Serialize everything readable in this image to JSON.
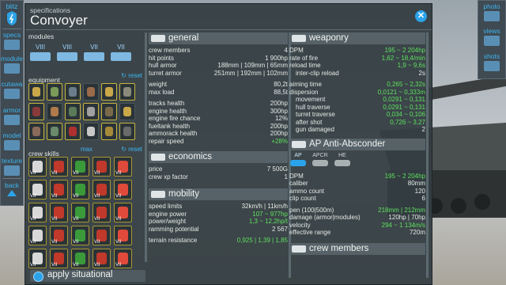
{
  "left_sidebar": [
    {
      "id": "blitz",
      "label": "blitz"
    },
    {
      "id": "specs",
      "label": "specs"
    },
    {
      "id": "module",
      "label": "module"
    },
    {
      "id": "cutaway",
      "label": "cutawa"
    },
    {
      "id": "armor",
      "label": "armor"
    },
    {
      "id": "model",
      "label": "model"
    },
    {
      "id": "texture",
      "label": "texture"
    },
    {
      "id": "back",
      "label": "back"
    }
  ],
  "right_sidebar": [
    {
      "id": "photo",
      "label": "photo"
    },
    {
      "id": "views",
      "label": "views"
    },
    {
      "id": "shots",
      "label": "shots"
    }
  ],
  "panel": {
    "subtitle": "specifications",
    "title": "Convoyer",
    "close_icon": "close-icon",
    "modules_label": "modules",
    "modules": [
      "VIII",
      "VIII",
      "VII",
      "VII"
    ],
    "equipment_label": "equipment",
    "reset_label": "reset",
    "crew_skills_label": "crew skills",
    "crew_max_label": "max",
    "equipment_cells": 18,
    "skill_levels": [
      "VII",
      "VII",
      "VII",
      "VII",
      "VII",
      "VII",
      "VII",
      "VII",
      "VII",
      "VII",
      "VII",
      "VII",
      "VII",
      "VII",
      "VII",
      "VII",
      "VII",
      "VII",
      "VII",
      "VII",
      "VII",
      "VII",
      "VII",
      "VII",
      "VII"
    ],
    "apply_label": "apply situational"
  },
  "general": {
    "header": "general",
    "rows1": [
      {
        "k": "crew members",
        "v": "4"
      },
      {
        "k": "hit points",
        "v": "1 900hp"
      },
      {
        "k": "hull armor",
        "v": "188mm | 109mm | 65mm"
      },
      {
        "k": "turret armor",
        "v": "251mm | 192mm | 102mm"
      }
    ],
    "rows2": [
      {
        "k": "weight",
        "v": "80,2t"
      },
      {
        "k": "max load",
        "v": "88,5t"
      }
    ],
    "rows3": [
      {
        "k": "tracks health",
        "v": "200hp"
      },
      {
        "k": "engine health",
        "v": "300hp"
      },
      {
        "k": "engine fire chance",
        "v": "12%"
      },
      {
        "k": "fueltank health",
        "v": "200hp"
      },
      {
        "k": "ammorack health",
        "v": "200hp"
      },
      {
        "k": "repair speed",
        "v": "+28%",
        "green": true
      }
    ]
  },
  "economics": {
    "header": "economics",
    "rows": [
      {
        "k": "price",
        "v": "7 500G"
      },
      {
        "k": "crew xp factor",
        "v": "1"
      }
    ]
  },
  "mobility": {
    "header": "mobility",
    "rows": [
      {
        "k": "speed limits",
        "v": "32km/h | 11km/h"
      },
      {
        "k": "engine power",
        "v": "107 ~ 977hp",
        "green": true
      },
      {
        "k": "power/weight",
        "v": "1,3 ~ 12,2hp/t",
        "green": true
      },
      {
        "k": "ramming potential",
        "v": "2 567"
      }
    ],
    "rows2": [
      {
        "k": "terrain resistance",
        "v": "0,925 | 1,39 | 1,85",
        "green": true
      }
    ]
  },
  "weaponry": {
    "header": "weaponry",
    "rows1": [
      {
        "k": "DPM",
        "v": "195 ~ 2 204hp",
        "green": true
      },
      {
        "k": "rate of fire",
        "v": "1,62 ~ 18,4/min",
        "green": true
      },
      {
        "k": "reload time",
        "v": "1,9 ~ 9,6s",
        "green": true
      },
      {
        "k": "inter-clip reload",
        "v": "2s",
        "ind": true
      }
    ],
    "rows2": [
      {
        "k": "aiming time",
        "v": "0,265 ~ 2,32s",
        "green": true
      },
      {
        "k": "dispersion",
        "v": "0,0121 ~ 0,333m",
        "green": true
      },
      {
        "k": "movement",
        "v": "0,0291 ~ 0,131",
        "green": true,
        "ind": true
      },
      {
        "k": "hull traverse",
        "v": "0,0291 ~ 0,131",
        "green": true,
        "ind": true
      },
      {
        "k": "turret traverse",
        "v": "0,034 ~ 0,106",
        "green": true,
        "ind": true
      },
      {
        "k": "after shot",
        "v": "0,726 ~ 3,27",
        "green": true,
        "ind": true
      },
      {
        "k": "gun damaged",
        "v": "2",
        "ind": true
      }
    ]
  },
  "gun": {
    "header": "AP Anti-Absconder",
    "ammo_types": [
      "AP",
      "APCR",
      "HE"
    ],
    "rows1": [
      {
        "k": "DPM",
        "v": "195 ~ 2 204hp",
        "green": true
      },
      {
        "k": "caliber",
        "v": "80mm"
      },
      {
        "k": "ammo count",
        "v": "120"
      },
      {
        "k": "clip count",
        "v": "6"
      }
    ],
    "rows2": [
      {
        "k": "pen (100|500m)",
        "v": "218mm | 212mm",
        "green": true
      },
      {
        "k": "damage (armor|modules)",
        "v": "120hp | 70hp"
      },
      {
        "k": "velocity",
        "v": "294 ~ 1 134m/s",
        "green": true
      },
      {
        "k": "effective range",
        "v": "720m"
      }
    ]
  },
  "crew": {
    "header": "crew members"
  }
}
